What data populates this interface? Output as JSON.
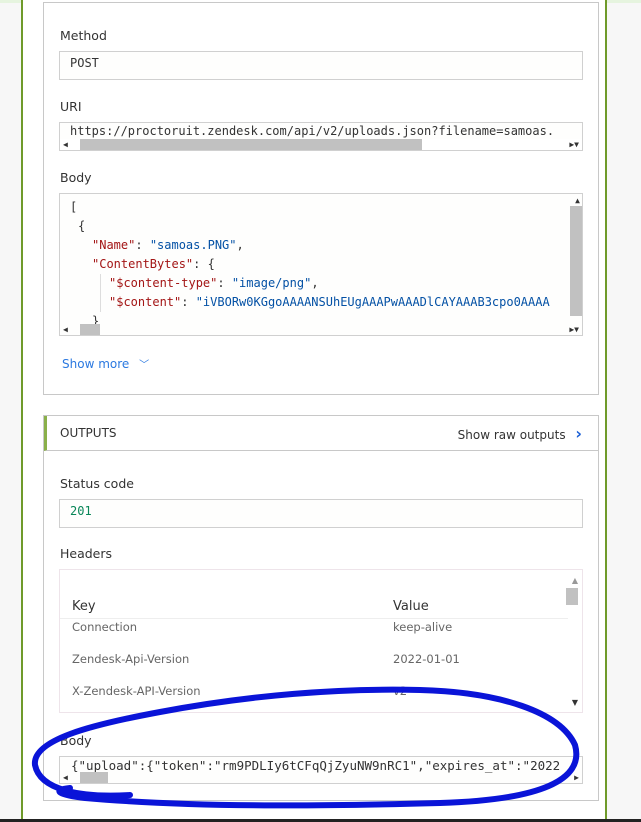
{
  "inputs": {
    "method_label": "Method",
    "method_value": "POST",
    "uri_label": "URI",
    "uri_value": "https://proctoruit.zendesk.com/api/v2/uploads.json?filename=samoas.",
    "body_label": "Body",
    "body_lines": {
      "l1": "[",
      "l2": "{",
      "l3k": "\"Name\"",
      "l3v": "\"samoas.PNG\"",
      "l4k": "\"ContentBytes\"",
      "l5k": "\"$content-type\"",
      "l5v": "\"image/png\"",
      "l6k": "\"$content\"",
      "l6v": "\"iVBORw0KGgoAAAANSUhEUgAAAPwAAADlCAYAAAB3cpo0AAAA",
      "l7": "}"
    },
    "show_more": "Show more"
  },
  "outputs": {
    "title": "OUTPUTS",
    "show_raw": "Show raw outputs",
    "status_label": "Status code",
    "status_value": "201",
    "headers_label": "Headers",
    "headers_columns": {
      "key": "Key",
      "value": "Value"
    },
    "headers_rows": [
      {
        "key": "Connection",
        "value": "keep-alive"
      },
      {
        "key": "Zendesk-Api-Version",
        "value": "2022-01-01"
      },
      {
        "key": "X-Zendesk-API-Version",
        "value": "v2"
      }
    ],
    "body_label": "Body",
    "body_value": "{\"upload\":{\"token\":\"rm9PDLIy6tCFqQjZyuNW9nRC1\",\"expires_at\":\"2022"
  },
  "annotation_color": "#0a14d8"
}
